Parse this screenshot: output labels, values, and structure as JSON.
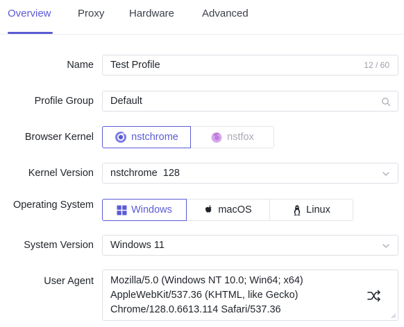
{
  "tabs": [
    {
      "label": "Overview",
      "active": true
    },
    {
      "label": "Proxy",
      "active": false
    },
    {
      "label": "Hardware",
      "active": false
    },
    {
      "label": "Advanced",
      "active": false
    }
  ],
  "form": {
    "name": {
      "label": "Name",
      "value": "Test Profile",
      "counter": "12 / 60"
    },
    "profile_group": {
      "label": "Profile Group",
      "value": "Default",
      "icon": "search-icon"
    },
    "browser_kernel": {
      "label": "Browser Kernel",
      "options": [
        {
          "label": "nstchrome",
          "icon": "chrome-icon",
          "selected": true
        },
        {
          "label": "nstfox",
          "icon": "firefox-icon",
          "selected": false
        }
      ]
    },
    "kernel_version": {
      "label": "Kernel Version",
      "value": "nstchrome  128",
      "icon": "chevron-down-icon"
    },
    "operating_system": {
      "label": "Operating System",
      "options": [
        {
          "label": "Windows",
          "icon": "windows-icon",
          "selected": true
        },
        {
          "label": "macOS",
          "icon": "apple-icon",
          "selected": false
        },
        {
          "label": "Linux",
          "icon": "linux-icon",
          "selected": false
        }
      ]
    },
    "system_version": {
      "label": "System Version",
      "value": "Windows 11",
      "icon": "chevron-down-icon"
    },
    "user_agent": {
      "label": "User Agent",
      "lines": [
        "Mozilla/5.0 (Windows NT 10.0; Win64; x64)",
        "AppleWebKit/537.36 (KHTML, like Gecko)",
        "Chrome/128.0.6613.114 Safari/537.36"
      ],
      "icon": "shuffle-icon"
    }
  },
  "colors": {
    "accent": "#5b5bd6",
    "border": "#dcdfe6",
    "muted": "#9aa0a8"
  }
}
